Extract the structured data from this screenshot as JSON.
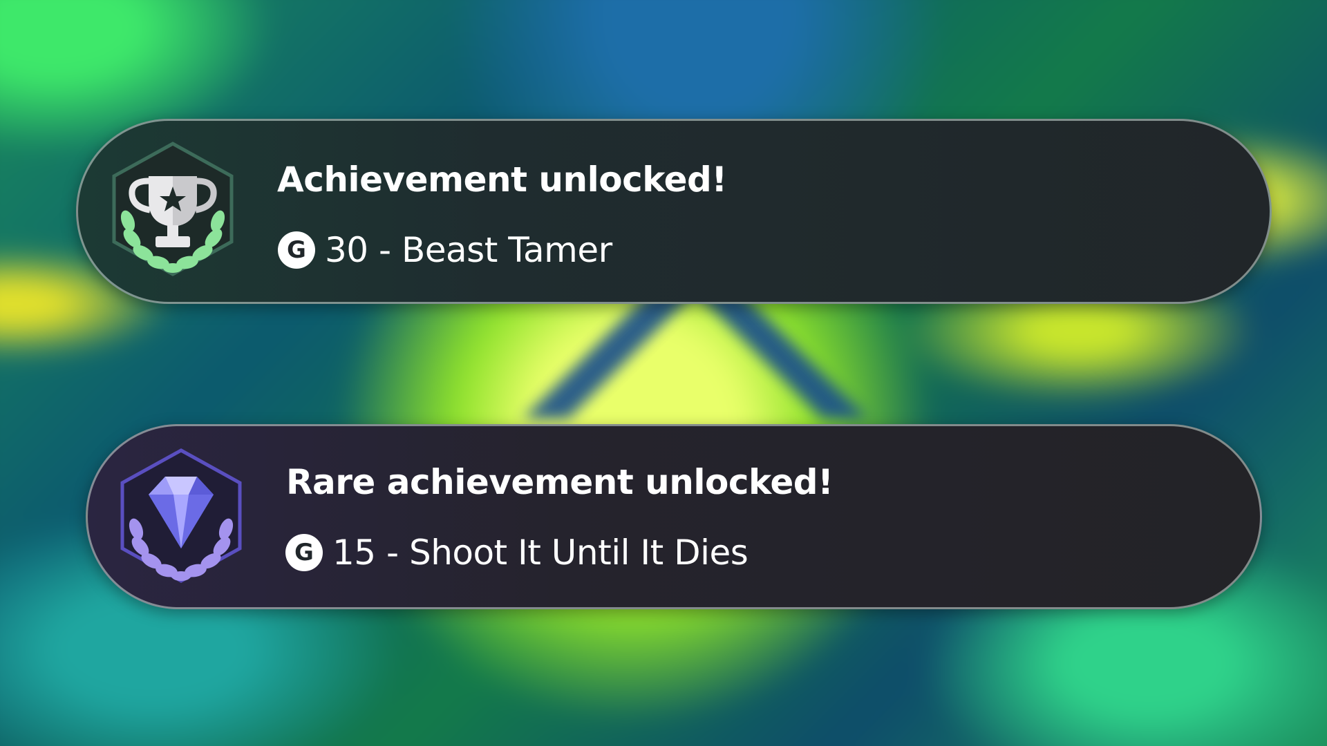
{
  "notifications": [
    {
      "title": "Achievement unlocked!",
      "gamerscore_icon": "G",
      "detail": "30 - Beast Tamer",
      "badge_icon": "trophy-icon",
      "accent": "#7fe08a"
    },
    {
      "title": "Rare achievement unlocked!",
      "gamerscore_icon": "G",
      "detail": "15 - Shoot It Until It Dies",
      "badge_icon": "diamond-icon",
      "accent": "#9b8cf0"
    }
  ]
}
